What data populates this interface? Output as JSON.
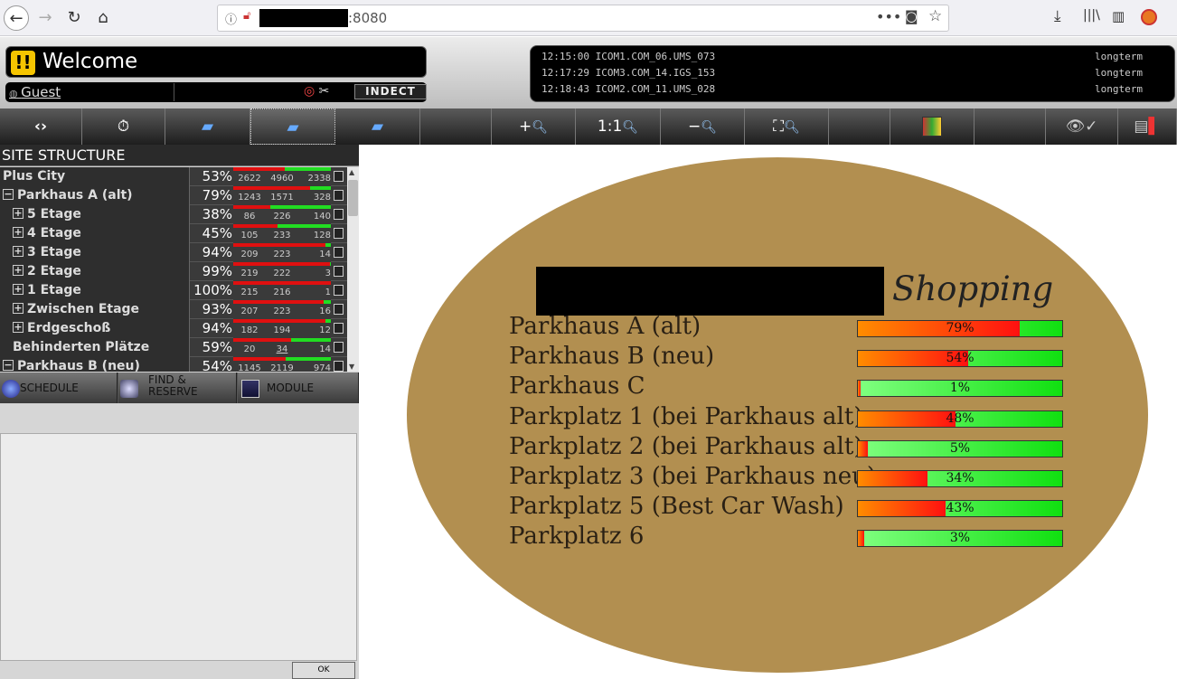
{
  "browser": {
    "url_suffix": ":8080",
    "icons": [
      "back-icon",
      "forward-icon",
      "reload-icon",
      "home-icon"
    ]
  },
  "header": {
    "welcome": "Welcome",
    "welcome_icon": "!!",
    "guest": "Guest",
    "logo": "INDECT"
  },
  "log": [
    {
      "time": "12:15:00",
      "source": "ICOM1.COM_06.UMS_073",
      "type": "longterm"
    },
    {
      "time": "12:17:29",
      "source": "ICOM3.COM_14.IGS_153",
      "type": "longterm"
    },
    {
      "time": "12:18:43",
      "source": "ICOM2.COM_11.UMS_028",
      "type": "longterm"
    }
  ],
  "toolbar": {
    "zoom_in": "+",
    "one_to_one": "1:1",
    "zoom_out": "−"
  },
  "site_structure": {
    "title": "SITE STRUCTURE",
    "rows": [
      {
        "name": "Plus City",
        "pct": "53%",
        "free": "2622",
        "total": "4960",
        "occ": "2338",
        "fill": 0.53,
        "exp": ""
      },
      {
        "name": "Parkhaus A (alt)",
        "pct": "79%",
        "free": "1243",
        "total": "1571",
        "occ": "328",
        "fill": 0.79,
        "exp": "−"
      },
      {
        "name": "5 Etage",
        "pct": "38%",
        "free": "86",
        "total": "226",
        "occ": "140",
        "fill": 0.38,
        "exp": "+"
      },
      {
        "name": "4 Etage",
        "pct": "45%",
        "free": "105",
        "total": "233",
        "occ": "128",
        "fill": 0.45,
        "exp": "+"
      },
      {
        "name": "3 Etage",
        "pct": "94%",
        "free": "209",
        "total": "223",
        "occ": "14",
        "fill": 0.94,
        "exp": "+"
      },
      {
        "name": "2 Etage",
        "pct": "99%",
        "free": "219",
        "total": "222",
        "occ": "3",
        "fill": 0.99,
        "exp": "+"
      },
      {
        "name": "1 Etage",
        "pct": "100%",
        "free": "215",
        "total": "216",
        "occ": "1",
        "fill": 1.0,
        "exp": "+"
      },
      {
        "name": "Zwischen Etage",
        "pct": "93%",
        "free": "207",
        "total": "223",
        "occ": "16",
        "fill": 0.93,
        "exp": "+"
      },
      {
        "name": "Erdgeschoß",
        "pct": "94%",
        "free": "182",
        "total": "194",
        "occ": "12",
        "fill": 0.94,
        "exp": "+"
      },
      {
        "name": "Behinderten Plätze",
        "pct": "59%",
        "free": "20",
        "total": "34",
        "occ": "14",
        "fill": 0.59,
        "exp": ""
      },
      {
        "name": "Parkhaus B (neu)",
        "pct": "54%",
        "free": "1145",
        "total": "2119",
        "occ": "974",
        "fill": 0.54,
        "exp": "−"
      }
    ]
  },
  "tabs": {
    "schedule": "SCHEDULE",
    "find_reserve": "FIND &\nRESERVE",
    "module": "MODULE"
  },
  "ok": "OK",
  "map": {
    "title": "Shopping",
    "rows": [
      {
        "name": "Parkhaus A (alt)",
        "pct": "79%",
        "fill": 0.79
      },
      {
        "name": "Parkhaus B (neu)",
        "pct": "54%",
        "fill": 0.54
      },
      {
        "name": "Parkhaus C",
        "pct": "1%",
        "fill": 0.01
      },
      {
        "name": "Parkplatz 1 (bei Parkhaus alt)",
        "pct": "48%",
        "fill": 0.48
      },
      {
        "name": "Parkplatz 2 (bei Parkhaus alt)",
        "pct": "5%",
        "fill": 0.05
      },
      {
        "name": "Parkplatz 3 (bei Parkhaus neu)",
        "pct": "34%",
        "fill": 0.34
      },
      {
        "name": "Parkplatz 5 (Best Car Wash)",
        "pct": "43%",
        "fill": 0.43
      },
      {
        "name": "Parkplatz 6",
        "pct": "3%",
        "fill": 0.03
      }
    ]
  }
}
